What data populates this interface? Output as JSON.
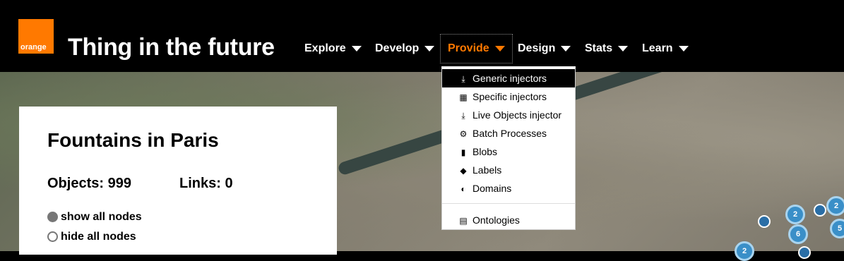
{
  "header": {
    "logo_text": "orange",
    "app_title": "Thing in the future",
    "nav": [
      {
        "label": "Explore"
      },
      {
        "label": "Develop"
      },
      {
        "label": "Provide"
      },
      {
        "label": "Design"
      },
      {
        "label": "Stats"
      },
      {
        "label": "Learn"
      }
    ],
    "accent_color": "#ff7900"
  },
  "dropdown": {
    "items": [
      {
        "label": "Generic injectors",
        "icon": "inject-icon"
      },
      {
        "label": "Specific injectors",
        "icon": "map-icon"
      },
      {
        "label": "Live Objects injector",
        "icon": "inject-icon"
      },
      {
        "label": "Batch Processes",
        "icon": "cogs-icon"
      },
      {
        "label": "Blobs",
        "icon": "file-icon"
      },
      {
        "label": "Labels",
        "icon": "tags-icon"
      },
      {
        "label": "Domains",
        "icon": "shield-icon"
      },
      {
        "label": "Ontologies",
        "icon": "file-text-icon"
      }
    ]
  },
  "panel": {
    "title": "Fountains in Paris",
    "objects_label": "Objects: 999",
    "links_label": "Links: 0",
    "show_all": "show all nodes",
    "hide_all": "hide all nodes"
  },
  "map": {
    "clusters": [
      {
        "count": "2"
      },
      {
        "count": "2"
      },
      {
        "count": "6"
      },
      {
        "count": "5"
      },
      {
        "count": "2"
      }
    ]
  }
}
